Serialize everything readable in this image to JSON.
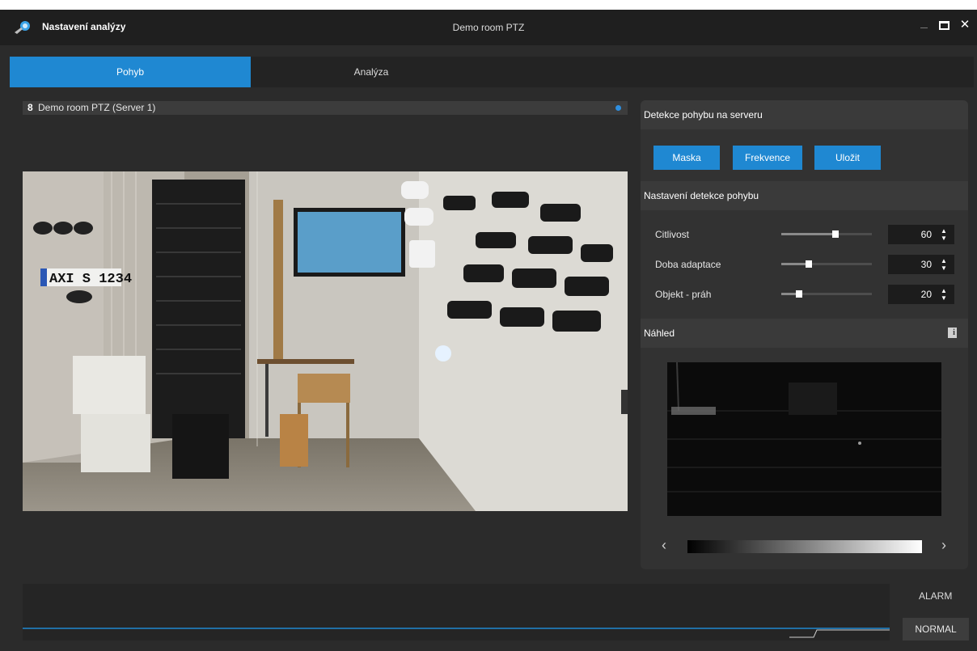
{
  "window": {
    "app_title": "Nastavení analýzy",
    "camera_title": "Demo room PTZ",
    "controls": {
      "minimize": "",
      "maximize": "",
      "close": "✕"
    }
  },
  "tabs": [
    {
      "label": "Pohyb",
      "active": true
    },
    {
      "label": "Analýza",
      "active": false
    }
  ],
  "camera": {
    "number": "8",
    "name": "Demo room PTZ (Server 1)",
    "plate_text": "AXI S 1234"
  },
  "panel": {
    "server_detection": {
      "title": "Detekce pohybu na serveru",
      "buttons": [
        "Maska",
        "Frekvence",
        "Uložit"
      ]
    },
    "settings": {
      "title": "Nastavení detekce pohybu",
      "rows": [
        {
          "label": "Citlivost",
          "value": "60",
          "level": 0.6
        },
        {
          "label": "Doba adaptace",
          "value": "30",
          "level": 0.3
        },
        {
          "label": "Objekt - práh",
          "value": "20",
          "level": 0.2
        }
      ]
    },
    "preview": {
      "title": "Náhled",
      "info_icon": "i",
      "prev_arrow": "‹",
      "next_arrow": "›"
    }
  },
  "level_indicator": {
    "alarm_label": "ALARM",
    "normal_label": "NORMAL"
  },
  "colors": {
    "accent": "#1f88d2",
    "background": "#2b2b2b",
    "titlebar": "#1f1f1f",
    "panel": "#323232"
  }
}
